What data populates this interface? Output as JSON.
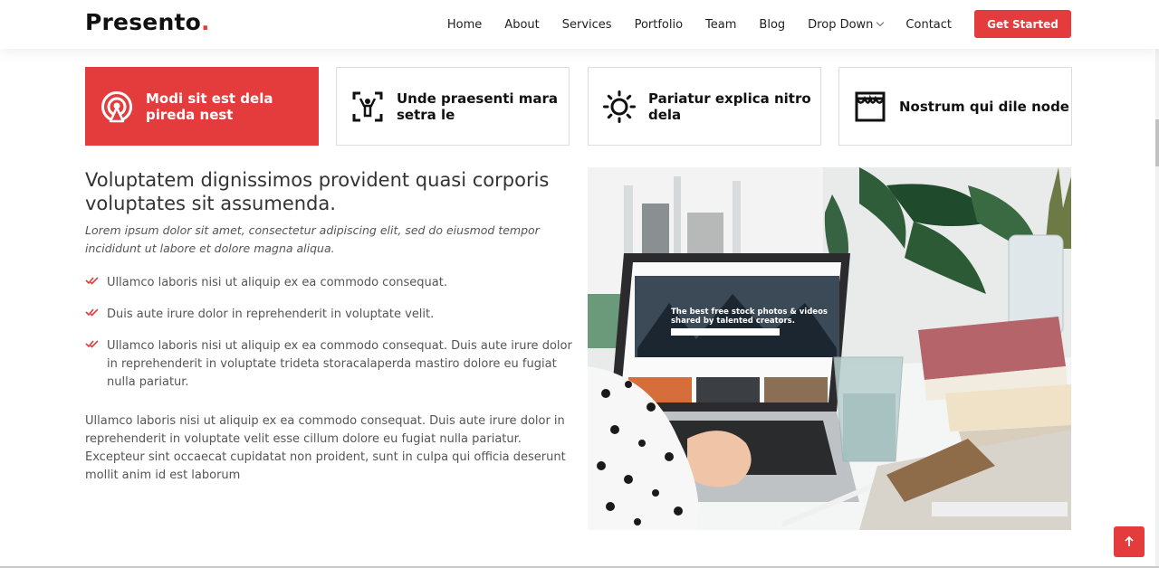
{
  "header": {
    "logo_text": "Presento",
    "logo_dot": ".",
    "nav": [
      "Home",
      "About",
      "Services",
      "Portfolio",
      "Team",
      "Blog",
      "Drop Down",
      "Contact"
    ],
    "cta_label": "Get Started"
  },
  "features": [
    {
      "title": "Modi sit est dela pireda nest",
      "icon": "broadcast-icon",
      "active": true
    },
    {
      "title": "Unde praesenti mara setra le",
      "icon": "person-frame-icon",
      "active": false
    },
    {
      "title": "Pariatur explica nitro dela",
      "icon": "sun-icon",
      "active": false
    },
    {
      "title": "Nostrum qui dile node",
      "icon": "store-icon",
      "active": false
    }
  ],
  "content": {
    "heading": "Voluptatem dignissimos provident quasi corporis voluptates sit assumenda.",
    "lead": "Lorem ipsum dolor sit amet, consectetur adipiscing elit, sed do eiusmod tempor incididunt ut labore et dolore magna aliqua.",
    "checks": [
      "Ullamco laboris nisi ut aliquip ex ea commodo consequat.",
      "Duis aute irure dolor in reprehenderit in voluptate velit.",
      "Ullamco laboris nisi ut aliquip ex ea commodo consequat. Duis aute irure dolor in reprehenderit in voluptate trideta storacalaperda mastiro dolore eu fugiat nulla pariatur."
    ],
    "paragraph": "Ullamco laboris nisi ut aliquip ex ea commodo consequat. Duis aute irure dolor in reprehenderit in voluptate velit esse cillum dolore eu fugiat nulla pariatur. Excepteur sint occaecat cupidatat non proident, sunt in culpa qui officia deserunt mollit anim id est laborum"
  },
  "photo": {
    "screen_line1": "The best free stock photos & videos",
    "screen_line2": "shared by talented creators."
  },
  "colors": {
    "accent": "#e43c3c",
    "text": "#444444",
    "heading": "#333333"
  }
}
